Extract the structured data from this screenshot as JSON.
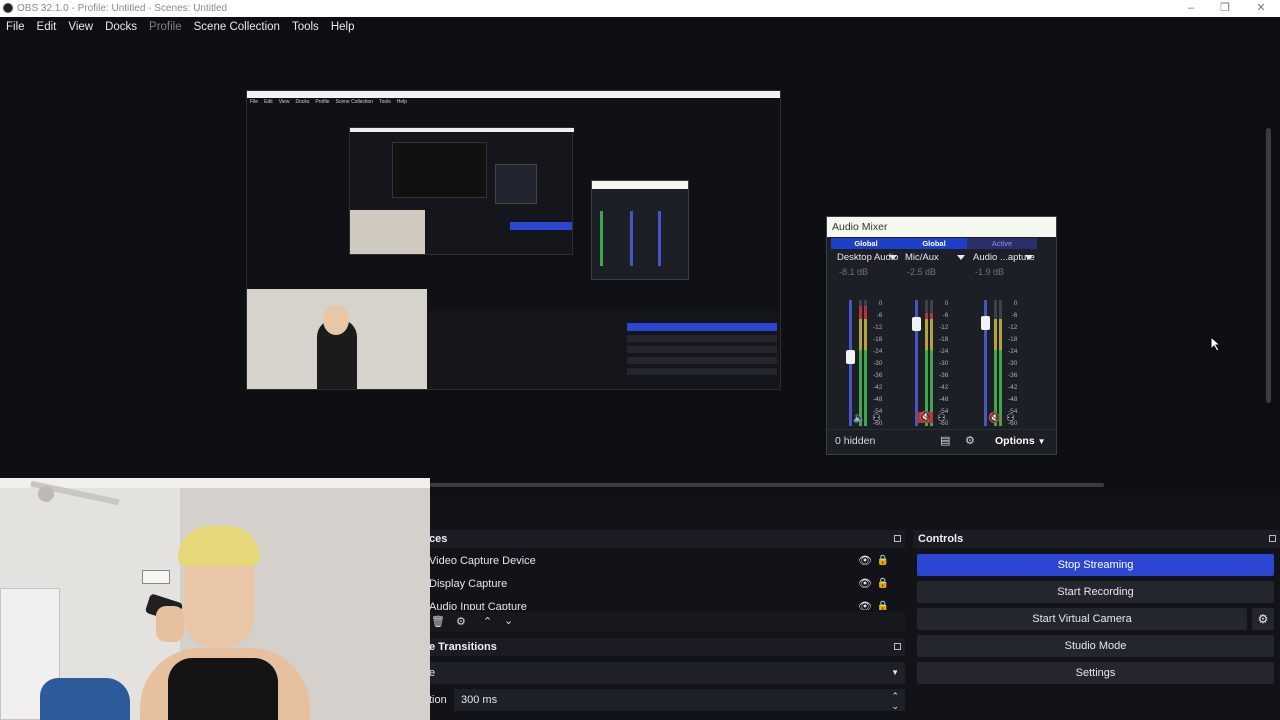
{
  "window": {
    "title": "OBS 32.1.0 - Profile: Untitled - Scenes: Untitled"
  },
  "menu": [
    "File",
    "Edit",
    "View",
    "Docks",
    "Profile",
    "Scene Collection",
    "Tools",
    "Help"
  ],
  "mixer": {
    "title": "Audio Mixer",
    "channels": [
      {
        "badge": "Global",
        "name": "Desktop Audio",
        "db": "-8.1 dB",
        "level": 0.55,
        "meter": 0.95
      },
      {
        "badge": "Global",
        "name": "Mic/Aux",
        "db": "-2.5 dB",
        "level": 0.85,
        "meter": 0.9
      },
      {
        "badge": "Active",
        "name": "Audio ...apture",
        "db": "-1.9 dB",
        "level": 0.86,
        "meter": 0.85
      }
    ],
    "scale": [
      "0",
      "-6",
      "-12",
      "-18",
      "-24",
      "-30",
      "-36",
      "-42",
      "-48",
      "-54",
      "-60"
    ],
    "hidden_label": "0 hidden",
    "options_label": "Options"
  },
  "sources": {
    "header": "ces",
    "items": [
      "Video Capture Device",
      "Display Capture",
      "Audio Input Capture"
    ]
  },
  "transitions": {
    "header": "e Transitions",
    "select_value": "e",
    "duration_label": "tion",
    "duration_value": "300 ms"
  },
  "controls": {
    "header": "Controls",
    "stop_streaming": "Stop Streaming",
    "start_recording": "Start Recording",
    "start_virtual_camera": "Start Virtual Camera",
    "studio_mode": "Studio Mode",
    "settings": "Settings"
  },
  "colors": {
    "accent": "#2c46d3",
    "bg": "#0e0f13",
    "panel": "#1d1f26"
  }
}
